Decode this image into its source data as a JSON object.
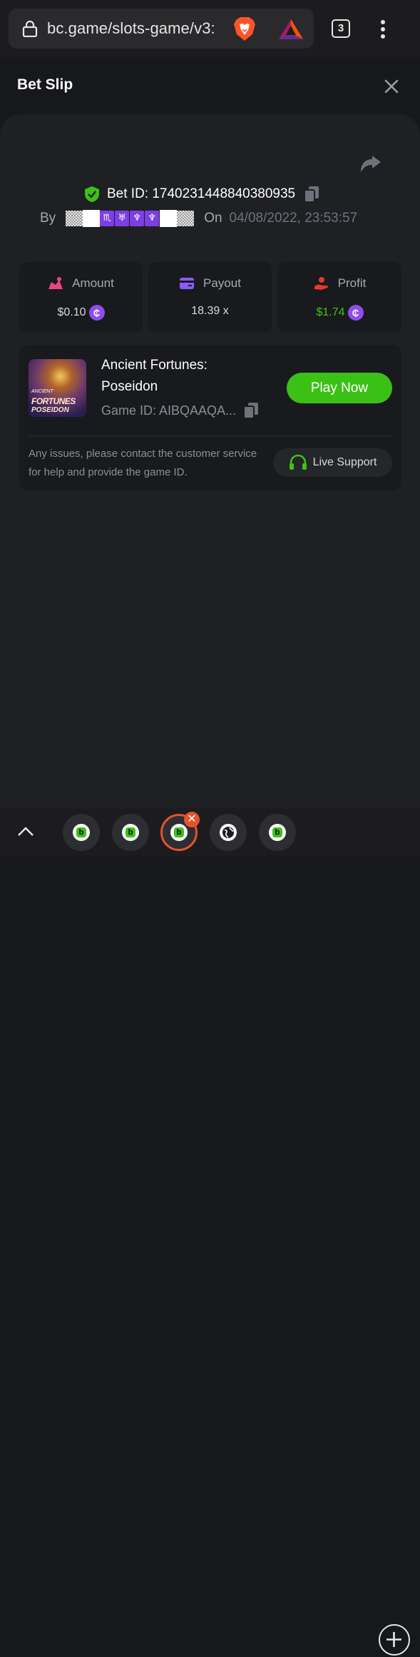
{
  "browser": {
    "url": "bc.game/slots-game/v3:",
    "tab_count": "3",
    "icons": [
      "lock-icon",
      "brave-lion-icon",
      "bat-rewards-icon",
      "menu-dots-icon"
    ]
  },
  "modal": {
    "title": "Bet Slip"
  },
  "bet": {
    "id_text": "Bet ID: 1740231448840380935",
    "by_label": "By",
    "username_symbols": [
      "♏",
      "♅",
      "♆",
      "♆"
    ],
    "on_label": "On",
    "date": "04/08/2022, 23:53:57"
  },
  "stats": {
    "amount": {
      "label": "Amount",
      "value": "$0.10",
      "color": "#e8457a"
    },
    "payout": {
      "label": "Payout",
      "value": "18.39 x",
      "color": "#8b5cf6"
    },
    "profit": {
      "label": "Profit",
      "value": "$1.74",
      "color": "#e5392e"
    },
    "coin_symbol": "₵"
  },
  "game": {
    "name": "Ancient Fortunes: Poseidon",
    "thumb_line1": "ANCIENT",
    "thumb_line2": "FORTUNES",
    "thumb_line3": "POSEIDON",
    "game_id": "Game ID: AIBQAAQA...",
    "play_label": "Play Now",
    "support_note": "Any issues, please contact the customer service for help and provide the game ID.",
    "live_support_label": "Live Support"
  },
  "bottom_tabs": {
    "count": 5,
    "active_index": 2,
    "close_symbol": "✕"
  },
  "colors": {
    "accent_green": "#3bc116",
    "background": "#17181b",
    "panel": "#1f2024",
    "card": "#191a1d"
  }
}
